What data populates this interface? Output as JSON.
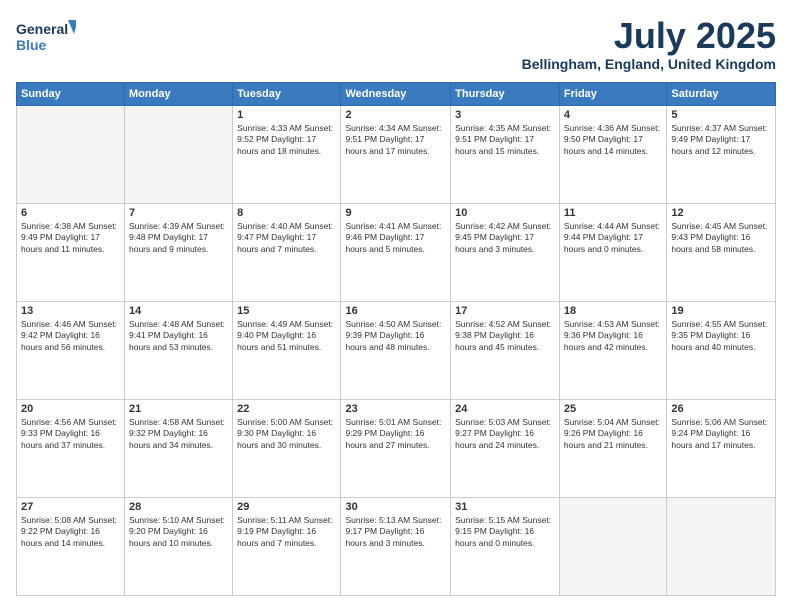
{
  "header": {
    "logo_line1": "General",
    "logo_line2": "Blue",
    "main_title": "July 2025",
    "subtitle": "Bellingham, England, United Kingdom"
  },
  "days_of_week": [
    "Sunday",
    "Monday",
    "Tuesday",
    "Wednesday",
    "Thursday",
    "Friday",
    "Saturday"
  ],
  "weeks": [
    [
      {
        "day": "",
        "info": ""
      },
      {
        "day": "",
        "info": ""
      },
      {
        "day": "1",
        "info": "Sunrise: 4:33 AM\nSunset: 9:52 PM\nDaylight: 17 hours and 18 minutes."
      },
      {
        "day": "2",
        "info": "Sunrise: 4:34 AM\nSunset: 9:51 PM\nDaylight: 17 hours and 17 minutes."
      },
      {
        "day": "3",
        "info": "Sunrise: 4:35 AM\nSunset: 9:51 PM\nDaylight: 17 hours and 15 minutes."
      },
      {
        "day": "4",
        "info": "Sunrise: 4:36 AM\nSunset: 9:50 PM\nDaylight: 17 hours and 14 minutes."
      },
      {
        "day": "5",
        "info": "Sunrise: 4:37 AM\nSunset: 9:49 PM\nDaylight: 17 hours and 12 minutes."
      }
    ],
    [
      {
        "day": "6",
        "info": "Sunrise: 4:38 AM\nSunset: 9:49 PM\nDaylight: 17 hours and 11 minutes."
      },
      {
        "day": "7",
        "info": "Sunrise: 4:39 AM\nSunset: 9:48 PM\nDaylight: 17 hours and 9 minutes."
      },
      {
        "day": "8",
        "info": "Sunrise: 4:40 AM\nSunset: 9:47 PM\nDaylight: 17 hours and 7 minutes."
      },
      {
        "day": "9",
        "info": "Sunrise: 4:41 AM\nSunset: 9:46 PM\nDaylight: 17 hours and 5 minutes."
      },
      {
        "day": "10",
        "info": "Sunrise: 4:42 AM\nSunset: 9:45 PM\nDaylight: 17 hours and 3 minutes."
      },
      {
        "day": "11",
        "info": "Sunrise: 4:44 AM\nSunset: 9:44 PM\nDaylight: 17 hours and 0 minutes."
      },
      {
        "day": "12",
        "info": "Sunrise: 4:45 AM\nSunset: 9:43 PM\nDaylight: 16 hours and 58 minutes."
      }
    ],
    [
      {
        "day": "13",
        "info": "Sunrise: 4:46 AM\nSunset: 9:42 PM\nDaylight: 16 hours and 56 minutes."
      },
      {
        "day": "14",
        "info": "Sunrise: 4:48 AM\nSunset: 9:41 PM\nDaylight: 16 hours and 53 minutes."
      },
      {
        "day": "15",
        "info": "Sunrise: 4:49 AM\nSunset: 9:40 PM\nDaylight: 16 hours and 51 minutes."
      },
      {
        "day": "16",
        "info": "Sunrise: 4:50 AM\nSunset: 9:39 PM\nDaylight: 16 hours and 48 minutes."
      },
      {
        "day": "17",
        "info": "Sunrise: 4:52 AM\nSunset: 9:38 PM\nDaylight: 16 hours and 45 minutes."
      },
      {
        "day": "18",
        "info": "Sunrise: 4:53 AM\nSunset: 9:36 PM\nDaylight: 16 hours and 42 minutes."
      },
      {
        "day": "19",
        "info": "Sunrise: 4:55 AM\nSunset: 9:35 PM\nDaylight: 16 hours and 40 minutes."
      }
    ],
    [
      {
        "day": "20",
        "info": "Sunrise: 4:56 AM\nSunset: 9:33 PM\nDaylight: 16 hours and 37 minutes."
      },
      {
        "day": "21",
        "info": "Sunrise: 4:58 AM\nSunset: 9:32 PM\nDaylight: 16 hours and 34 minutes."
      },
      {
        "day": "22",
        "info": "Sunrise: 5:00 AM\nSunset: 9:30 PM\nDaylight: 16 hours and 30 minutes."
      },
      {
        "day": "23",
        "info": "Sunrise: 5:01 AM\nSunset: 9:29 PM\nDaylight: 16 hours and 27 minutes."
      },
      {
        "day": "24",
        "info": "Sunrise: 5:03 AM\nSunset: 9:27 PM\nDaylight: 16 hours and 24 minutes."
      },
      {
        "day": "25",
        "info": "Sunrise: 5:04 AM\nSunset: 9:26 PM\nDaylight: 16 hours and 21 minutes."
      },
      {
        "day": "26",
        "info": "Sunrise: 5:06 AM\nSunset: 9:24 PM\nDaylight: 16 hours and 17 minutes."
      }
    ],
    [
      {
        "day": "27",
        "info": "Sunrise: 5:08 AM\nSunset: 9:22 PM\nDaylight: 16 hours and 14 minutes."
      },
      {
        "day": "28",
        "info": "Sunrise: 5:10 AM\nSunset: 9:20 PM\nDaylight: 16 hours and 10 minutes."
      },
      {
        "day": "29",
        "info": "Sunrise: 5:11 AM\nSunset: 9:19 PM\nDaylight: 16 hours and 7 minutes."
      },
      {
        "day": "30",
        "info": "Sunrise: 5:13 AM\nSunset: 9:17 PM\nDaylight: 16 hours and 3 minutes."
      },
      {
        "day": "31",
        "info": "Sunrise: 5:15 AM\nSunset: 9:15 PM\nDaylight: 16 hours and 0 minutes."
      },
      {
        "day": "",
        "info": ""
      },
      {
        "day": "",
        "info": ""
      }
    ]
  ]
}
